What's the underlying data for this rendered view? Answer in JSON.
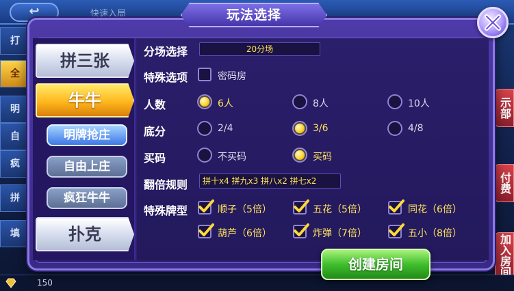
{
  "background": {
    "back_label": "↩",
    "quick_entry": "快速入局",
    "left_tabs": [
      "打",
      "全",
      "明",
      "自",
      "疯",
      "拼",
      "填"
    ],
    "right_tabs": [
      "示部",
      "付费",
      "加入房间"
    ],
    "diamond_count": "150"
  },
  "dialog": {
    "title": "玩法选择",
    "categories": [
      {
        "label": "拼三张",
        "active": false
      },
      {
        "label": "牛牛",
        "active": true
      },
      {
        "label": "扑克",
        "active": false
      }
    ],
    "sub_modes": [
      {
        "label": "明牌抢庄",
        "active": true
      },
      {
        "label": "自由上庄",
        "active": false
      },
      {
        "label": "疯狂牛牛",
        "active": false
      }
    ],
    "rows": {
      "venue": {
        "label": "分场选择",
        "value": "20分场"
      },
      "special": {
        "label": "特殊选项",
        "option": "密码房",
        "checked": false
      },
      "players": {
        "label": "人数",
        "options": [
          "6人",
          "8人",
          "10人"
        ],
        "selected": 0
      },
      "base_score": {
        "label": "底分",
        "options": [
          "2/4",
          "3/6",
          "4/8"
        ],
        "selected": 1
      },
      "buy_code": {
        "label": "买码",
        "options": [
          "不买码",
          "买码"
        ],
        "selected": 1
      },
      "multiplier_rule": {
        "label": "翻倍规则",
        "value": "拼十x4 拼九x3 拼八x2 拼七x2"
      },
      "special_cards": {
        "label": "特殊牌型",
        "items": [
          {
            "label": "顺子（5倍）",
            "checked": true
          },
          {
            "label": "五花（5倍）",
            "checked": true
          },
          {
            "label": "同花（6倍）",
            "checked": true
          },
          {
            "label": "葫芦（6倍）",
            "checked": true
          },
          {
            "label": "炸弹（7倍）",
            "checked": true
          },
          {
            "label": "五小（8倍）",
            "checked": true
          }
        ]
      }
    },
    "create_button": "创建房间"
  },
  "colors": {
    "accent_yellow": "#ffe35b",
    "dialog_purple": "#3a2a87",
    "create_green": "#3fbf2d",
    "active_category": "#ffb71c"
  },
  "icons": {
    "close": "close-icon",
    "check": "check-icon",
    "diamond": "diamond-icon"
  }
}
